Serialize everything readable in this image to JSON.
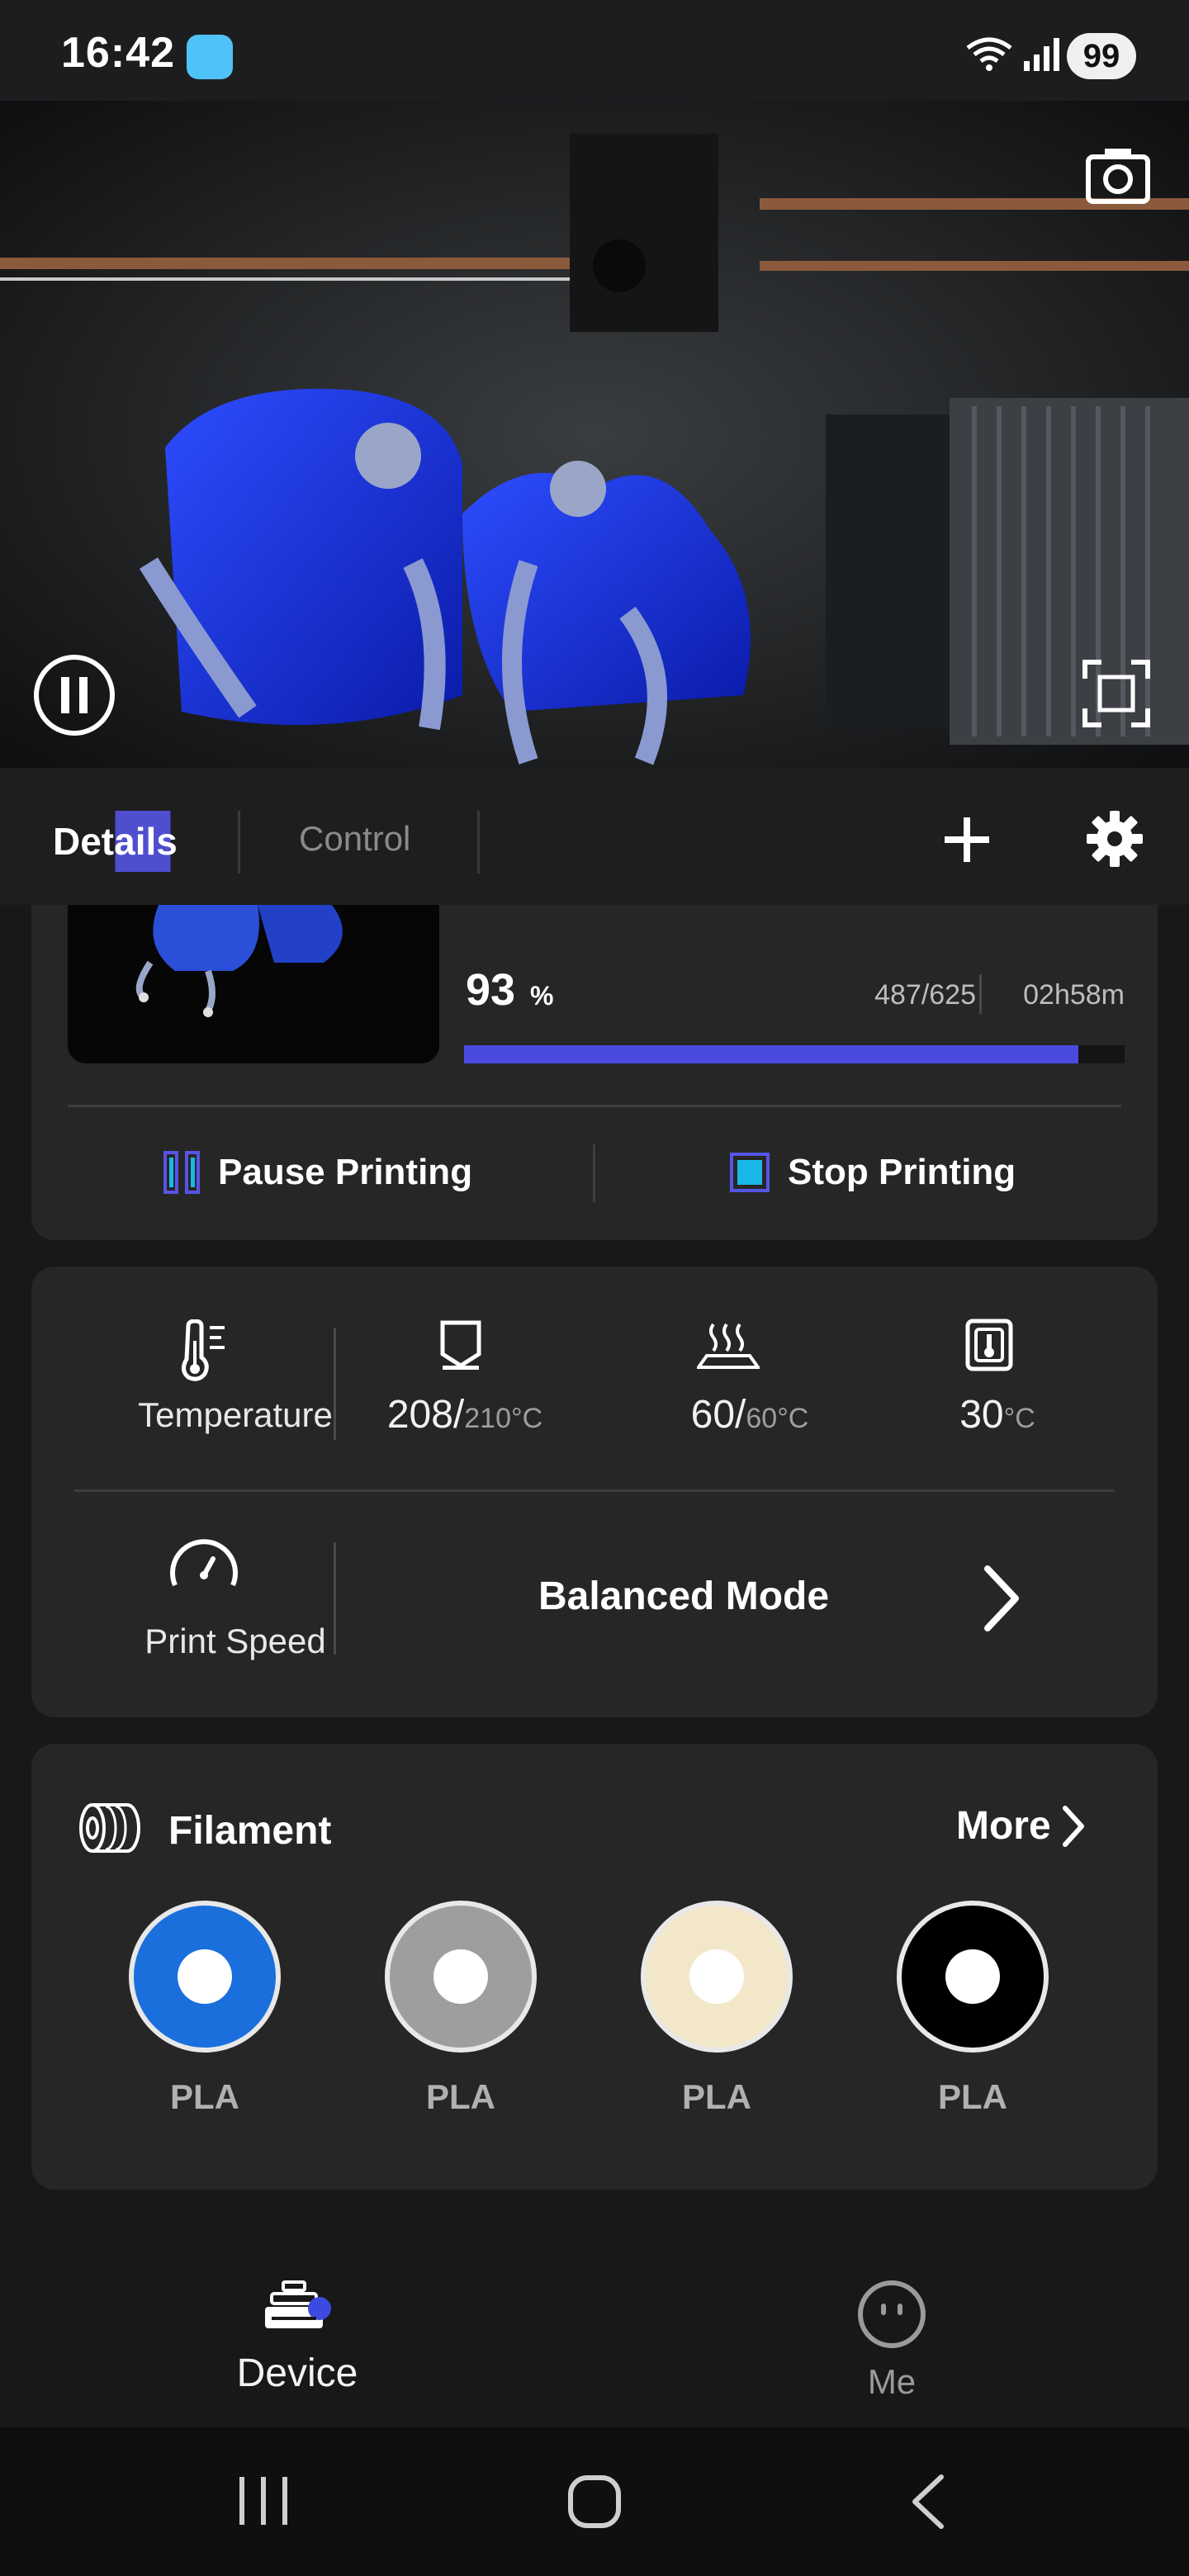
{
  "status_bar": {
    "time": "16:42",
    "battery": "99"
  },
  "tabs": {
    "details": "Details",
    "control": "Control"
  },
  "print": {
    "progress": "93",
    "progress_unit": "%",
    "progress_fraction": 0.93,
    "layers": "487/625",
    "time_left": "02h58m",
    "pause_label": "Pause Printing",
    "stop_label": "Stop Printing"
  },
  "temperature": {
    "label": "Temperature",
    "nozzle_current": "208/",
    "nozzle_target": "210°C",
    "bed_current": "60/",
    "bed_target": "60°C",
    "chamber_current": "30",
    "chamber_unit": "°C"
  },
  "speed": {
    "label": "Print Speed",
    "mode": "Balanced Mode"
  },
  "filament": {
    "title": "Filament",
    "more_label": "More",
    "slots": [
      {
        "material": "PLA",
        "color": "#1a6fdc"
      },
      {
        "material": "PLA",
        "color": "#9e9e9e"
      },
      {
        "material": "PLA",
        "color": "#f3e7c9"
      },
      {
        "material": "PLA",
        "color": "#000000"
      }
    ]
  },
  "bottom_nav": {
    "device": "Device",
    "me": "Me"
  },
  "colors": {
    "accent": "#4a4ae0",
    "stop": "#19b8e8",
    "card": "#262626"
  }
}
